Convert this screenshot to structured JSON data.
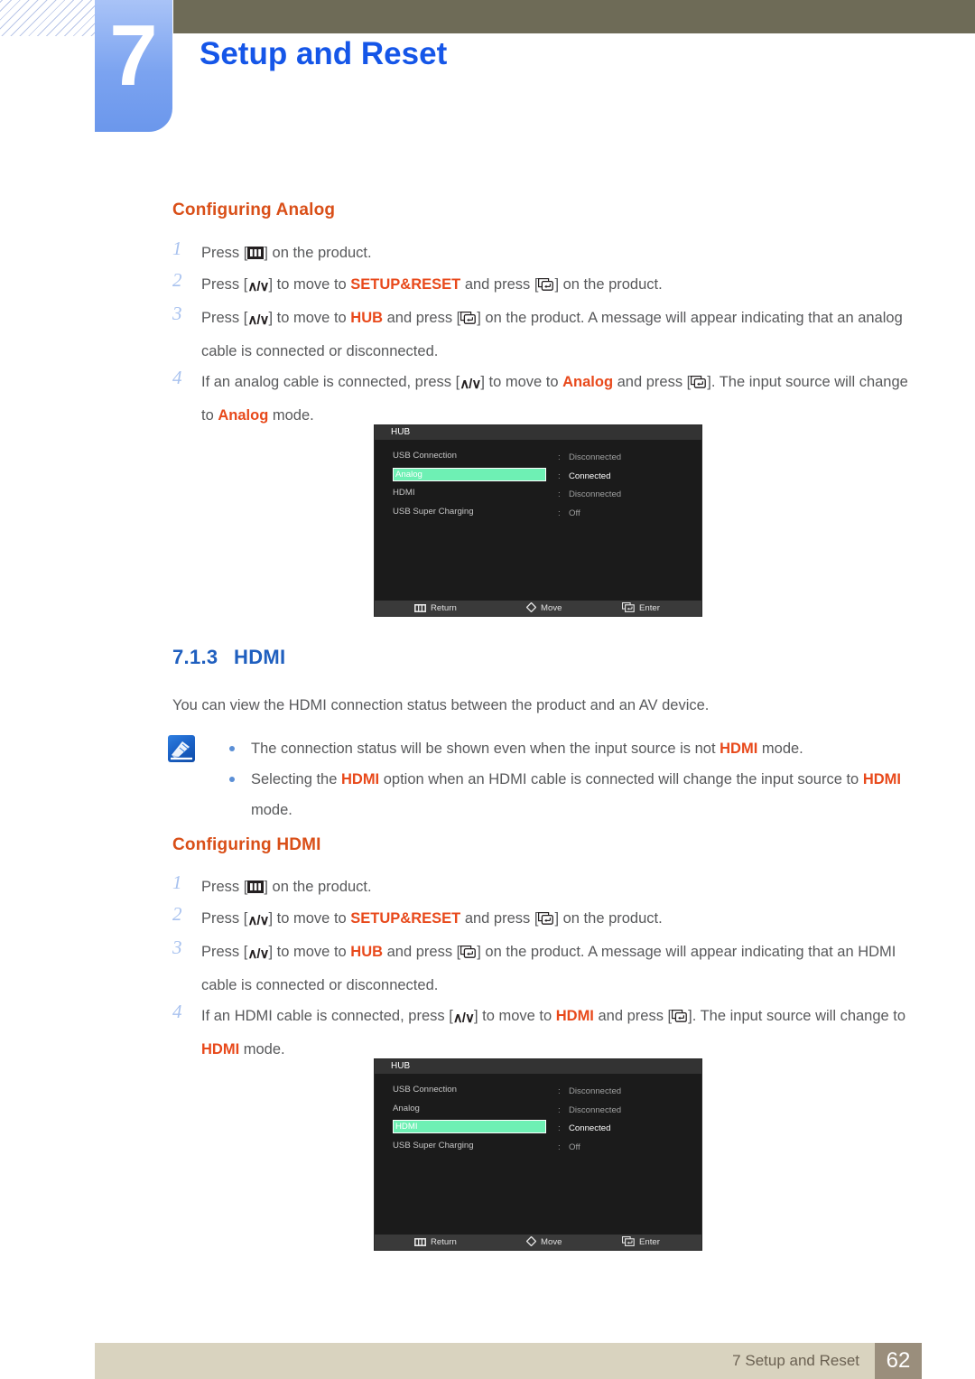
{
  "header": {
    "chapter_number": "7",
    "chapter_title": "Setup and Reset"
  },
  "analog_section": {
    "heading": "Configuring Analog",
    "steps": [
      {
        "marker": "1",
        "parts": [
          {
            "t": "Press [",
            "k": "plain"
          },
          {
            "t": "",
            "k": "menu-icon"
          },
          {
            "t": "] on the product.",
            "k": "plain"
          }
        ]
      },
      {
        "marker": "2",
        "parts": [
          {
            "t": "Press [",
            "k": "plain"
          },
          {
            "t": "",
            "k": "updown-icon"
          },
          {
            "t": "] to move to ",
            "k": "plain"
          },
          {
            "t": "SETUP&RESET",
            "k": "hl"
          },
          {
            "t": " and press [",
            "k": "plain"
          },
          {
            "t": "",
            "k": "enter-icon"
          },
          {
            "t": "] on the product.",
            "k": "plain"
          }
        ]
      },
      {
        "marker": "3",
        "parts": [
          {
            "t": "Press [",
            "k": "plain"
          },
          {
            "t": "",
            "k": "updown-icon"
          },
          {
            "t": "] to move to ",
            "k": "plain"
          },
          {
            "t": "HUB",
            "k": "hl"
          },
          {
            "t": " and press [",
            "k": "plain"
          },
          {
            "t": "",
            "k": "enter-icon"
          },
          {
            "t": "] on the product. A message will appear indicating that an analog cable is connected or disconnected.",
            "k": "plain"
          }
        ]
      },
      {
        "marker": "4",
        "parts": [
          {
            "t": "If an analog cable is connected, press [",
            "k": "plain"
          },
          {
            "t": "",
            "k": "updown-icon"
          },
          {
            "t": "] to move to ",
            "k": "plain"
          },
          {
            "t": "Analog",
            "k": "hl"
          },
          {
            "t": " and press [",
            "k": "plain"
          },
          {
            "t": "",
            "k": "enter-icon"
          },
          {
            "t": "]. The input source will change to ",
            "k": "plain"
          },
          {
            "t": "Analog",
            "k": "hl"
          },
          {
            "t": " mode.",
            "k": "plain"
          }
        ]
      }
    ]
  },
  "hdmi_section": {
    "number": "7.1.3",
    "title": "HDMI",
    "intro": "You can view the HDMI connection status between the product and an AV device.",
    "notes": [
      [
        {
          "t": "The connection status will be shown even when the input source is not ",
          "k": "plain"
        },
        {
          "t": "HDMI",
          "k": "hl"
        },
        {
          "t": " mode.",
          "k": "plain"
        }
      ],
      [
        {
          "t": "Selecting the ",
          "k": "plain"
        },
        {
          "t": "HDMI",
          "k": "hl"
        },
        {
          "t": " option when an HDMI cable is connected will change the input source to ",
          "k": "plain"
        },
        {
          "t": "HDMI",
          "k": "hl"
        },
        {
          "t": " mode.",
          "k": "plain"
        }
      ]
    ]
  },
  "configuring_hdmi": {
    "heading": "Configuring HDMI",
    "steps": [
      {
        "marker": "1",
        "parts": [
          {
            "t": "Press [",
            "k": "plain"
          },
          {
            "t": "",
            "k": "menu-icon"
          },
          {
            "t": "] on the product.",
            "k": "plain"
          }
        ]
      },
      {
        "marker": "2",
        "parts": [
          {
            "t": "Press [",
            "k": "plain"
          },
          {
            "t": "",
            "k": "updown-icon"
          },
          {
            "t": "] to move to ",
            "k": "plain"
          },
          {
            "t": "SETUP&RESET",
            "k": "hl"
          },
          {
            "t": " and press [",
            "k": "plain"
          },
          {
            "t": "",
            "k": "enter-icon"
          },
          {
            "t": "] on the product.",
            "k": "plain"
          }
        ]
      },
      {
        "marker": "3",
        "parts": [
          {
            "t": "Press [",
            "k": "plain"
          },
          {
            "t": "",
            "k": "updown-icon"
          },
          {
            "t": "] to move to ",
            "k": "plain"
          },
          {
            "t": "HUB",
            "k": "hl"
          },
          {
            "t": " and press [",
            "k": "plain"
          },
          {
            "t": "",
            "k": "enter-icon"
          },
          {
            "t": "] on the product. A message will appear indicating that an HDMI cable is connected or disconnected.",
            "k": "plain"
          }
        ]
      },
      {
        "marker": "4",
        "parts": [
          {
            "t": "If an HDMI cable is connected, press [",
            "k": "plain"
          },
          {
            "t": "",
            "k": "updown-icon"
          },
          {
            "t": "] to move to ",
            "k": "plain"
          },
          {
            "t": "HDMI",
            "k": "hl"
          },
          {
            "t": " and press [",
            "k": "plain"
          },
          {
            "t": "",
            "k": "enter-icon"
          },
          {
            "t": "]. The input source will change to ",
            "k": "plain"
          },
          {
            "t": "HDMI",
            "k": "hl"
          },
          {
            "t": " mode.",
            "k": "plain"
          }
        ]
      }
    ]
  },
  "osd_analog": {
    "title": "HUB",
    "rows": [
      {
        "label": "USB Connection",
        "value": "Disconnected",
        "selected": false
      },
      {
        "label": "Analog",
        "value": "Connected",
        "selected": true
      },
      {
        "label": "HDMI",
        "value": "Disconnected",
        "selected": false
      },
      {
        "label": "USB Super Charging",
        "value": "Off",
        "selected": false
      }
    ],
    "bottom": {
      "return": "Return",
      "move": "Move",
      "enter": "Enter"
    }
  },
  "osd_hdmi": {
    "title": "HUB",
    "rows": [
      {
        "label": "USB Connection",
        "value": "Disconnected",
        "selected": false
      },
      {
        "label": "Analog",
        "value": "Disconnected",
        "selected": false
      },
      {
        "label": "HDMI",
        "value": "Connected",
        "selected": true
      },
      {
        "label": "USB Super Charging",
        "value": "Off",
        "selected": false
      }
    ],
    "bottom": {
      "return": "Return",
      "move": "Move",
      "enter": "Enter"
    }
  },
  "footer": {
    "text": "7 Setup and Reset",
    "page": "62"
  },
  "colors": {
    "accent_orange": "#e8491b",
    "heading_blue": "#1f5fbf",
    "title_blue": "#1556e8",
    "olive": "#6e6b57",
    "osd_highlight": "#6ef0b4",
    "footer_bar": "#d9d3bf",
    "footer_page": "#9a8e7c"
  }
}
